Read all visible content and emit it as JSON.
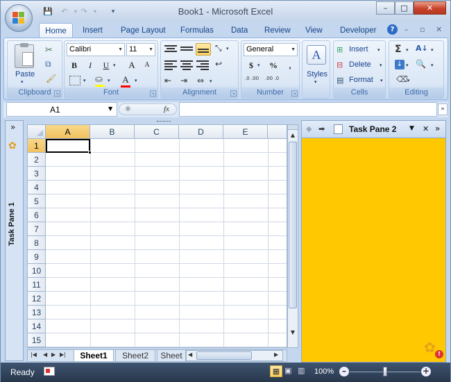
{
  "window": {
    "title": "Book1 - Microsoft Excel",
    "min": "–",
    "max": "□",
    "close": "✕"
  },
  "qat": {
    "save": "💾",
    "undo": "↶",
    "redo": "↷",
    "customize": "▾"
  },
  "tabs": [
    "Home",
    "Insert",
    "Page Layout",
    "Formulas",
    "Data",
    "Review",
    "View",
    "Developer"
  ],
  "help": "?",
  "ribbon": {
    "clipboard": {
      "label": "Clipboard",
      "paste": "Paste"
    },
    "font": {
      "label": "Font",
      "name": "Calibri",
      "size": "11",
      "bold": "B",
      "italic": "I",
      "underline": "U",
      "grow": "A",
      "shrink": "A",
      "font_color_label": "A",
      "highlight_color": "#ffff00",
      "font_color": "#ff0000"
    },
    "alignment": {
      "label": "Alignment"
    },
    "number": {
      "label": "Number",
      "format": "General",
      "currency": "$",
      "percent": "%",
      "comma": ",",
      "inc_dec": ".0 .00",
      "dec_dec": ".00 .0"
    },
    "styles": {
      "label": "Styles"
    },
    "cells": {
      "label": "Cells",
      "insert": "Insert",
      "delete": "Delete",
      "format": "Format"
    },
    "editing": {
      "label": "Editing"
    }
  },
  "formula_bar": {
    "name_box": "A1",
    "fx": "fx",
    "value": ""
  },
  "task_pane_1": {
    "title": "Task Pane 1",
    "collapse": "»"
  },
  "task_pane_2": {
    "title": "Task Pane 2",
    "dropdown": "▼",
    "close": "✕",
    "collapse": "»",
    "background": "#ffc800"
  },
  "grid": {
    "columns": [
      "A",
      "B",
      "C",
      "D",
      "E"
    ],
    "rows": [
      "1",
      "2",
      "3",
      "4",
      "5",
      "6",
      "7",
      "8",
      "9",
      "10",
      "11",
      "12",
      "13",
      "14",
      "15"
    ],
    "active_cell": "A1"
  },
  "sheets": [
    "Sheet1",
    "Sheet2",
    "Sheet"
  ],
  "status": {
    "ready": "Ready",
    "zoom": "100%"
  }
}
